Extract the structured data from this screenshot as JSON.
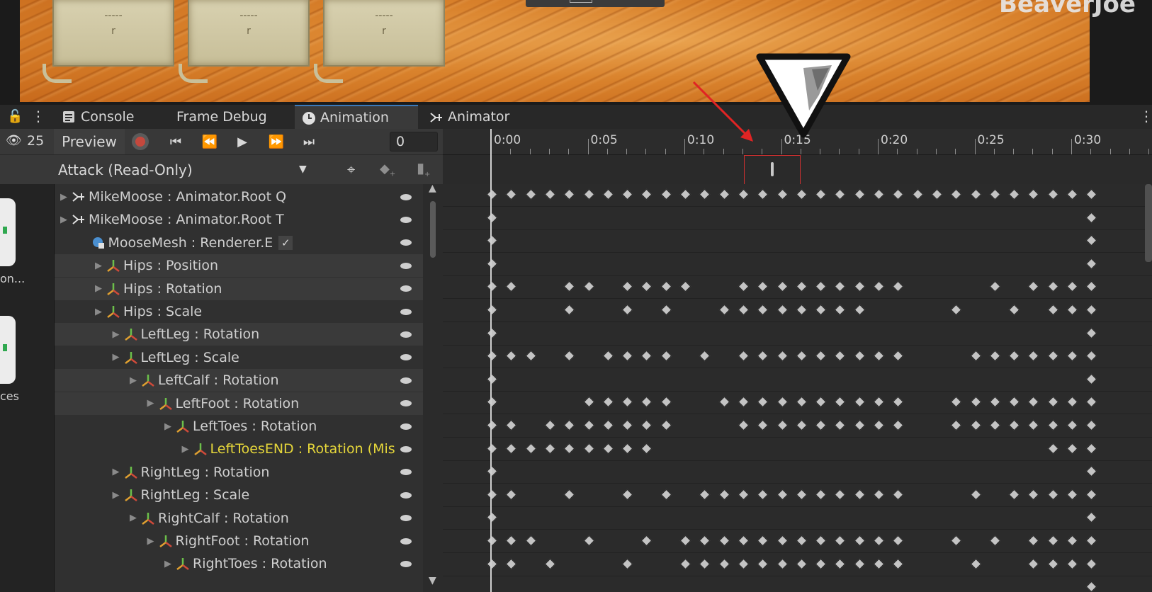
{
  "scene": {
    "cards": [
      {
        "dash": "-----",
        "letter": "r"
      },
      {
        "dash": "-----",
        "letter": "r"
      },
      {
        "dash": "-----",
        "letter": "r"
      }
    ],
    "watermark": "BeaverJoe"
  },
  "tabs": [
    {
      "label": "Console",
      "icon": "console-list-icon"
    },
    {
      "label": "Frame Debug",
      "icon": ""
    },
    {
      "label": "Animation",
      "icon": "clock-icon"
    },
    {
      "label": "Animator",
      "icon": "animator-icon"
    }
  ],
  "toolbar": {
    "hidden_count": "25",
    "preview_label": "Preview",
    "frame_value": "0"
  },
  "clip": {
    "name": "Attack (Read-Only)"
  },
  "left_strip": {
    "asset1_label": "on...",
    "asset2_label": "ces"
  },
  "timeline": {
    "labels": [
      "0:00",
      "0:05",
      "0:10",
      "0:15",
      "0:20",
      "0:25",
      "0:30"
    ]
  },
  "properties": [
    {
      "label": "MikeMoose : Animator.Root Q",
      "indent": 0,
      "icon": "animator-root-icon",
      "hl": false
    },
    {
      "label": "MikeMoose : Animator.Root T",
      "indent": 0,
      "icon": "animator-root-icon",
      "hl": false
    },
    {
      "label": "MooseMesh : Renderer.E",
      "indent": 1,
      "icon": "renderer-icon",
      "hl": false,
      "check": true
    },
    {
      "label": "Hips : Position",
      "indent": 2,
      "icon": "transform-icon",
      "hl": true
    },
    {
      "label": "Hips : Rotation",
      "indent": 2,
      "icon": "transform-icon",
      "hl": true
    },
    {
      "label": "Hips : Scale",
      "indent": 2,
      "icon": "transform-icon",
      "hl": false
    },
    {
      "label": "LeftLeg : Rotation",
      "indent": 3,
      "icon": "transform-icon",
      "hl": true
    },
    {
      "label": "LeftLeg : Scale",
      "indent": 3,
      "icon": "transform-icon",
      "hl": false
    },
    {
      "label": "LeftCalf : Rotation",
      "indent": 4,
      "icon": "transform-icon",
      "hl": true
    },
    {
      "label": "LeftFoot : Rotation",
      "indent": 5,
      "icon": "transform-icon",
      "hl": true
    },
    {
      "label": "LeftToes : Rotation",
      "indent": 6,
      "icon": "transform-icon",
      "hl": false
    },
    {
      "label": "LeftToesEND : Rotation (Mis",
      "indent": 7,
      "icon": "transform-icon",
      "hl": false,
      "missing": true
    },
    {
      "label": "RightLeg : Rotation",
      "indent": 3,
      "icon": "transform-icon",
      "hl": false
    },
    {
      "label": "RightLeg : Scale",
      "indent": 3,
      "icon": "transform-icon",
      "hl": false
    },
    {
      "label": "RightCalf : Rotation",
      "indent": 4,
      "icon": "transform-icon",
      "hl": false
    },
    {
      "label": "RightFoot : Rotation",
      "indent": 5,
      "icon": "transform-icon",
      "hl": false
    },
    {
      "label": "RightToes : Rotation",
      "indent": 6,
      "icon": "transform-icon",
      "hl": false
    }
  ],
  "keyframe_frames": [
    [
      0,
      1,
      2,
      3,
      4,
      5,
      6,
      7,
      8,
      9,
      10,
      11,
      12,
      13,
      14,
      15,
      16,
      17,
      18,
      19,
      20,
      21,
      22,
      23,
      24,
      25,
      26,
      27,
      28,
      29,
      30,
      31
    ],
    [
      0,
      31
    ],
    [
      0,
      31
    ],
    [
      0,
      31
    ],
    [
      0,
      1,
      4,
      5,
      7,
      8,
      9,
      10,
      13,
      14,
      15,
      16,
      17,
      18,
      19,
      20,
      21,
      26,
      28,
      29,
      30,
      31
    ],
    [
      0,
      4,
      7,
      9,
      12,
      13,
      14,
      15,
      16,
      17,
      18,
      19,
      24,
      27,
      29,
      30,
      31
    ],
    [
      0,
      31
    ],
    [
      0,
      1,
      2,
      4,
      6,
      7,
      8,
      9,
      11,
      13,
      14,
      15,
      16,
      17,
      18,
      19,
      20,
      21,
      25,
      26,
      27,
      28,
      29,
      30,
      31
    ],
    [
      0,
      31
    ],
    [
      0,
      5,
      6,
      7,
      8,
      9,
      12,
      13,
      14,
      15,
      16,
      17,
      18,
      19,
      20,
      21,
      24,
      25,
      26,
      27,
      28,
      29,
      30,
      31
    ],
    [
      0,
      1,
      3,
      4,
      5,
      6,
      7,
      8,
      9,
      13,
      14,
      15,
      16,
      17,
      18,
      19,
      20,
      21,
      24,
      25,
      26,
      27,
      28,
      29,
      30,
      31
    ],
    [
      0,
      1,
      2,
      3,
      4,
      5,
      6,
      7,
      8,
      29,
      30,
      31
    ],
    [
      0,
      31
    ],
    [
      0,
      1,
      4,
      7,
      9,
      11,
      12,
      13,
      14,
      15,
      16,
      17,
      18,
      19,
      20,
      21,
      25,
      27,
      28,
      29,
      30,
      31
    ],
    [
      0,
      31
    ],
    [
      0,
      1,
      2,
      5,
      8,
      10,
      11,
      12,
      13,
      14,
      15,
      16,
      17,
      18,
      19,
      20,
      21,
      24,
      26,
      28,
      29,
      30,
      31
    ],
    [
      0,
      1,
      3,
      7,
      10,
      11,
      12,
      13,
      14,
      15,
      16,
      17,
      18,
      19,
      20,
      21,
      25,
      28,
      29,
      30,
      31
    ],
    [
      31
    ]
  ]
}
